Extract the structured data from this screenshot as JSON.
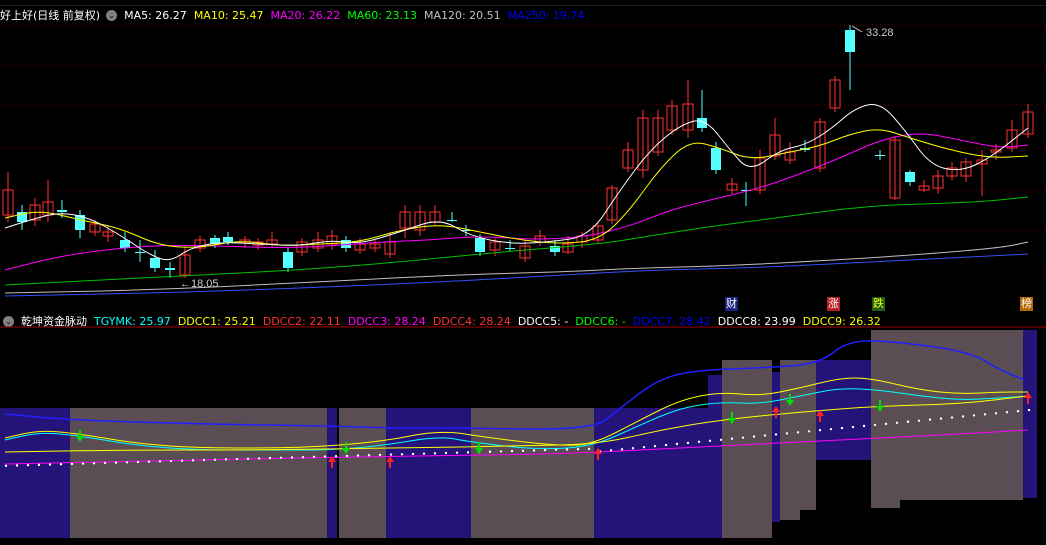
{
  "main": {
    "title": "好上好(日线 前复权)",
    "collapse_glyph": "⌄",
    "ma": [
      {
        "label": "MA5: 26.27",
        "color": "#ffffff"
      },
      {
        "label": "MA10: 25.47",
        "color": "#ffff00"
      },
      {
        "label": "MA20: 26.22",
        "color": "#ff00ff"
      },
      {
        "label": "MA60: 23.13",
        "color": "#00ff00"
      },
      {
        "label": "MA120: 20.51",
        "color": "#c0c0c0"
      },
      {
        "label": "MA250: 19.74",
        "color": "#0000ff"
      }
    ],
    "high_label": "33.28",
    "low_label": "18.05",
    "markers": [
      {
        "text": "财",
        "color": "#ffffff",
        "bg": "#1a237e"
      },
      {
        "text": "涨",
        "color": "#ffffff",
        "bg": "#b71c1c"
      },
      {
        "text": "跌",
        "color": "#ffff00",
        "bg": "#1b5e20"
      },
      {
        "text": "榜",
        "color": "#ffffff",
        "bg": "#b26a00"
      }
    ]
  },
  "sub": {
    "title": "乾坤资金脉动",
    "collapse_glyph": "⌄",
    "indicators": [
      {
        "label": "TGYMK: 25.97",
        "color": "#00ffff"
      },
      {
        "label": "DDCC1: 25.21",
        "color": "#ffff00"
      },
      {
        "label": "DDCC2: 22.11",
        "color": "#ff3333"
      },
      {
        "label": "DDCC3: 28.24",
        "color": "#ff00ff"
      },
      {
        "label": "DDCC4: 28.24",
        "color": "#ff3333"
      },
      {
        "label": "DDCC5: -",
        "color": "#ffffff"
      },
      {
        "label": "DDCC6: -",
        "color": "#00ff00"
      },
      {
        "label": "DDCC7: 28.42",
        "color": "#0000ff"
      },
      {
        "label": "DDCC8: 23.99",
        "color": "#ffffff"
      },
      {
        "label": "DDCC9: 26.32",
        "color": "#ffff00"
      }
    ]
  },
  "colors": {
    "up": "#ff3333",
    "down": "#54ffff",
    "grid": "#8b0000",
    "band_gray": "#5a4e54",
    "band_blue": "#24147a"
  }
}
